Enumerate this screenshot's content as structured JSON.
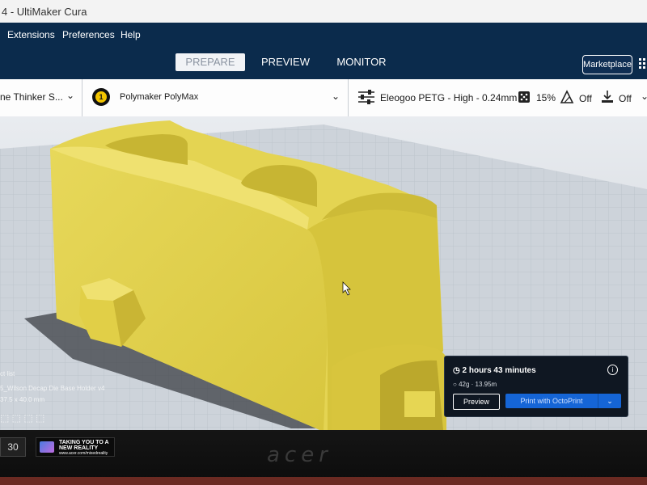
{
  "window": {
    "title": "4 - UltiMaker Cura"
  },
  "menu": {
    "items": [
      "Extensions",
      "Preferences",
      "Help"
    ]
  },
  "stages": {
    "tabs": [
      "PREPARE",
      "PREVIEW",
      "MONITOR"
    ],
    "active": "PREPARE"
  },
  "marketplace": {
    "label": "Marketplace"
  },
  "settings": {
    "printer": "ne Thinker S...",
    "extruder_number": "1",
    "material": "Polymaker PolyMax",
    "profile": "Eleogoo PETG - High - 0.24mm",
    "infill": "15%",
    "support": "Off",
    "adhesion": "Off"
  },
  "object": {
    "list_label": "ct list",
    "name": "5_Wilson Decap Die Base Holder v4",
    "dimensions": "37.5 x 40.0 mm"
  },
  "print_panel": {
    "time": "2 hours 43 minutes",
    "material_usage": "42g · 13.95m",
    "info_icon": "i",
    "preview_button": "Preview",
    "print_button": "Print with OctoPrint"
  },
  "hardware": {
    "brand": "acer",
    "badge": "30",
    "sticker_line1": "TAKING YOU TO A",
    "sticker_line2": "NEW REALITY",
    "sticker_line3": "www.acer.com/mixedreality"
  },
  "colors": {
    "header_bg": "#0b2b4c",
    "model_yellow": "#e2d24c",
    "print_button": "#1565d6",
    "panel_bg": "#0f1722"
  }
}
